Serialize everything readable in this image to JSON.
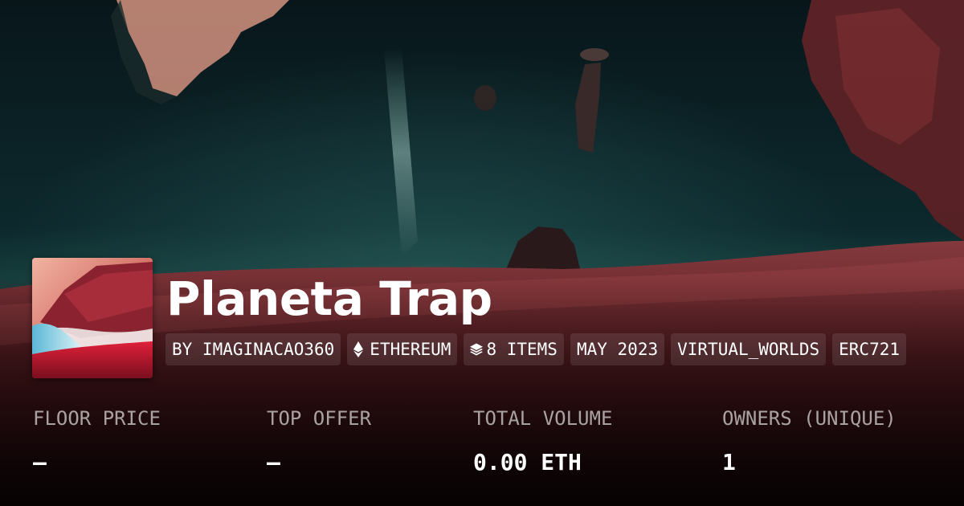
{
  "collection": {
    "title": "Planeta Trap"
  },
  "tags": [
    {
      "label": "BY IMAGINACAO360",
      "icon": null
    },
    {
      "label": "ETHEREUM",
      "icon": "ethereum-icon"
    },
    {
      "label": "8 ITEMS",
      "icon": "layers-icon"
    },
    {
      "label": "MAY 2023",
      "icon": null
    },
    {
      "label": "VIRTUAL_WORLDS",
      "icon": null
    },
    {
      "label": "ERC721",
      "icon": null
    }
  ],
  "stats": [
    {
      "label": "FLOOR PRICE",
      "value": "–"
    },
    {
      "label": "TOP OFFER",
      "value": "–"
    },
    {
      "label": "TOTAL VOLUME",
      "value": "0.00 ETH"
    },
    {
      "label": "OWNERS (UNIQUE)",
      "value": "1"
    }
  ],
  "colors": {
    "pill_background": "#ffffff1a",
    "label": "#ffffff9e",
    "text": "#ffffff"
  }
}
